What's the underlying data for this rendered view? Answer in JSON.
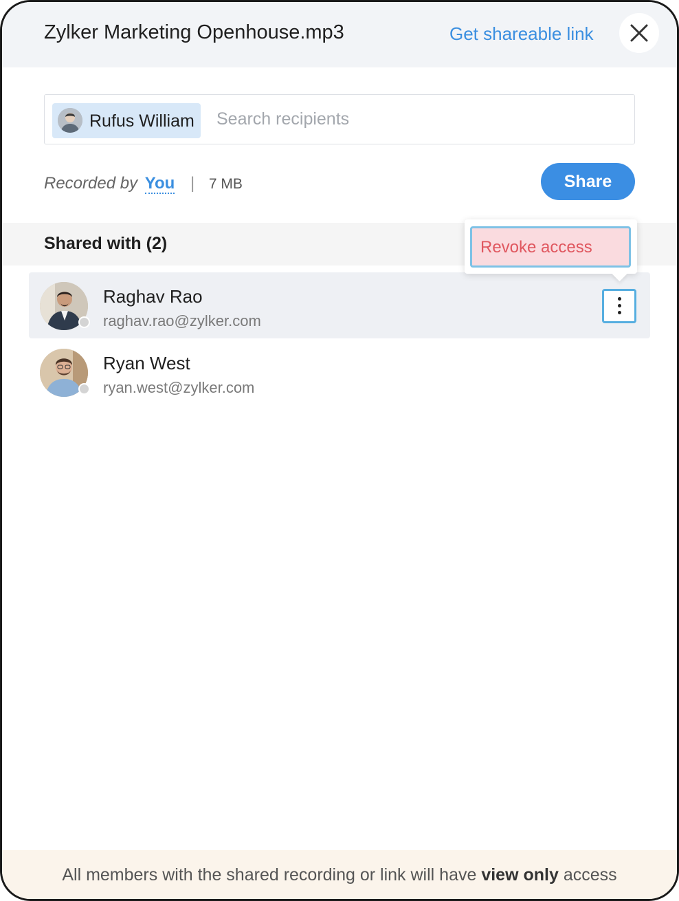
{
  "dialog": {
    "title": "Zylker Marketing Openhouse.mp3",
    "get_link_label": "Get shareable link",
    "close_icon": "close-icon"
  },
  "recipients": {
    "chip_label": "Rufus William",
    "search_placeholder": "Search recipients"
  },
  "meta": {
    "recorded_by_label": "Recorded by",
    "recorded_by_value": "You",
    "separator": "|",
    "size": "7 MB"
  },
  "share_label": "Share",
  "shared_with": {
    "title": "Shared with (2)",
    "members": [
      {
        "name": "Raghav Rao",
        "email": "raghav.rao@zylker.com",
        "status": "offline"
      },
      {
        "name": "Ryan West",
        "email": "ryan.west@zylker.com",
        "status": "offline"
      }
    ]
  },
  "menu": {
    "revoke_label": "Revoke access"
  },
  "footer": {
    "prefix": "All members with the shared recording or link will have",
    "emphasis": "view only",
    "suffix": "access"
  },
  "colors": {
    "accent": "#3b8ee3",
    "link": "#3b8fe0",
    "danger_text": "#e0575f",
    "danger_bg": "#fadbdf",
    "focus_ring": "#56aee0",
    "footer_bg": "#fbf4eb"
  }
}
